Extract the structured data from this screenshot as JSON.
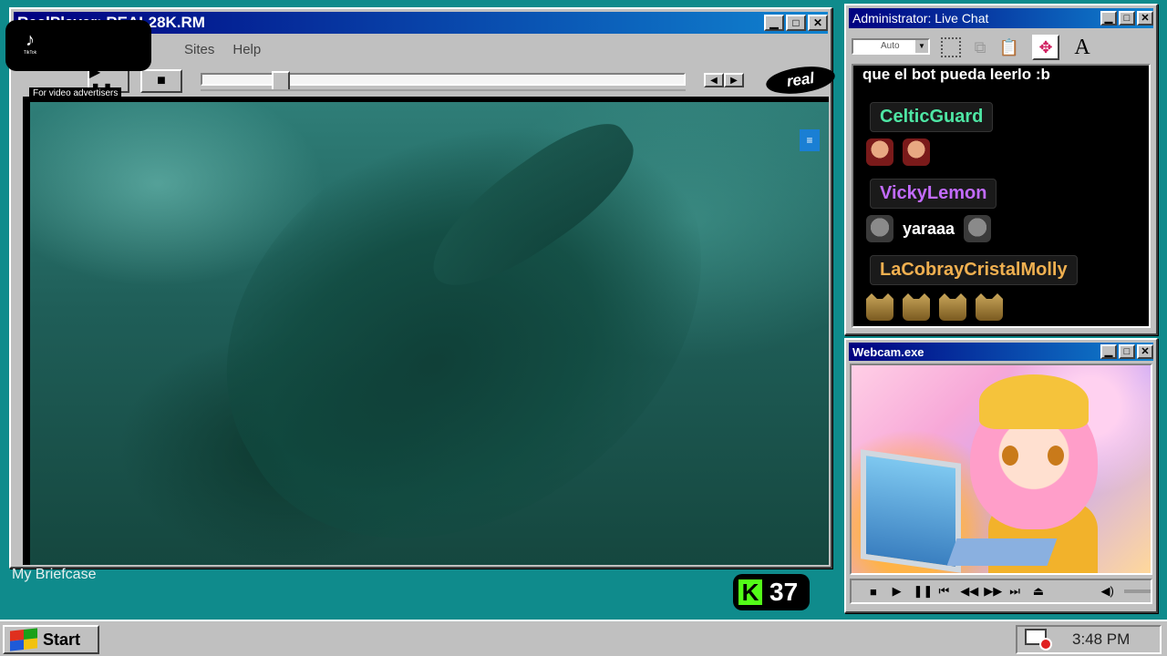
{
  "realplayer": {
    "title": "RealPlayer: REAL28K.RM",
    "menu": [
      "Sites",
      "Help"
    ],
    "play_pause_label": "▶ ❚❚",
    "stop_label": "■",
    "logo_text": "real",
    "seek_position": 0.15,
    "video_menu_label": "≡"
  },
  "tiktok": {
    "label": "TikTok",
    "advertisers_text": "For video advertisers"
  },
  "desktop": {
    "icon_label": "My Briefcase"
  },
  "kick": {
    "logo": "K",
    "count": "37",
    "accent": "#53fc18"
  },
  "chat": {
    "title": "Administrator: Live Chat",
    "font_size_value": "Auto",
    "font_tool_label": "A",
    "top_line": "que el bot pueda leerlo :b",
    "messages": [
      {
        "user": "CelticGuard",
        "color": "#4ee6a4",
        "text": ""
      },
      {
        "user": "VickyLemon",
        "color": "#c26bff",
        "text": "yaraaa"
      },
      {
        "user": "LaCobrayCristalMolly",
        "color": "#f0b050",
        "text": ""
      }
    ]
  },
  "webcam": {
    "title": "Webcam.exe"
  },
  "taskbar": {
    "start_label": "Start",
    "clock": "3:48 PM"
  },
  "window_buttons": {
    "minimize": "▁",
    "maximize": "□",
    "close": "✕"
  },
  "colors": {
    "desktop": "#0f8b8c",
    "titlebar": "#000080"
  }
}
